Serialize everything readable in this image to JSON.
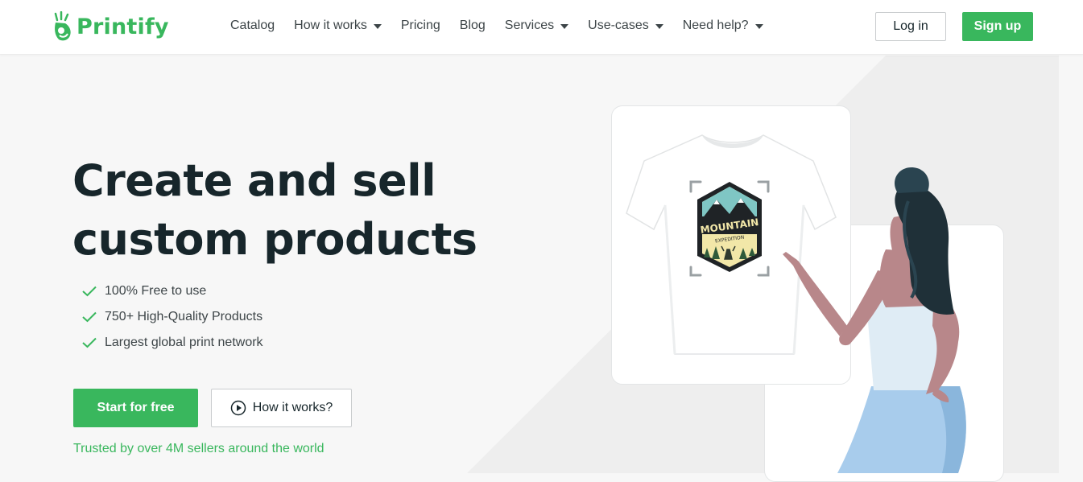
{
  "brand": {
    "name": "Printify",
    "color": "#39b75d",
    "logo_icon": "printify-logo-icon"
  },
  "nav": [
    {
      "label": "Catalog",
      "dropdown": false
    },
    {
      "label": "How it works",
      "dropdown": true
    },
    {
      "label": "Pricing",
      "dropdown": false
    },
    {
      "label": "Blog",
      "dropdown": false
    },
    {
      "label": "Services",
      "dropdown": true
    },
    {
      "label": "Use-cases",
      "dropdown": true
    },
    {
      "label": "Need help?",
      "dropdown": true
    }
  ],
  "auth": {
    "login_label": "Log in",
    "signup_label": "Sign up"
  },
  "hero": {
    "headline_line1": "Create and sell",
    "headline_line2": "custom products",
    "features": [
      "100% Free to use",
      "750+ High-Quality Products",
      "Largest global print network"
    ],
    "cta_primary": "Start for free",
    "cta_secondary": "How it works?",
    "trusted_text": "Trusted by over 4M sellers around the world"
  },
  "product_preview": {
    "badge_title": "MOUNTAIN",
    "badge_subtitle": "EXPEDITION"
  },
  "colors": {
    "accent": "#39b75d",
    "text_dark": "#17262b",
    "background": "#f7f7f7",
    "skirt_blue": "#a8ccec",
    "skin": "#b8878a",
    "hair": "#1f3038"
  },
  "icons": [
    "chevron-down-icon",
    "check-icon",
    "play-circle-icon"
  ]
}
